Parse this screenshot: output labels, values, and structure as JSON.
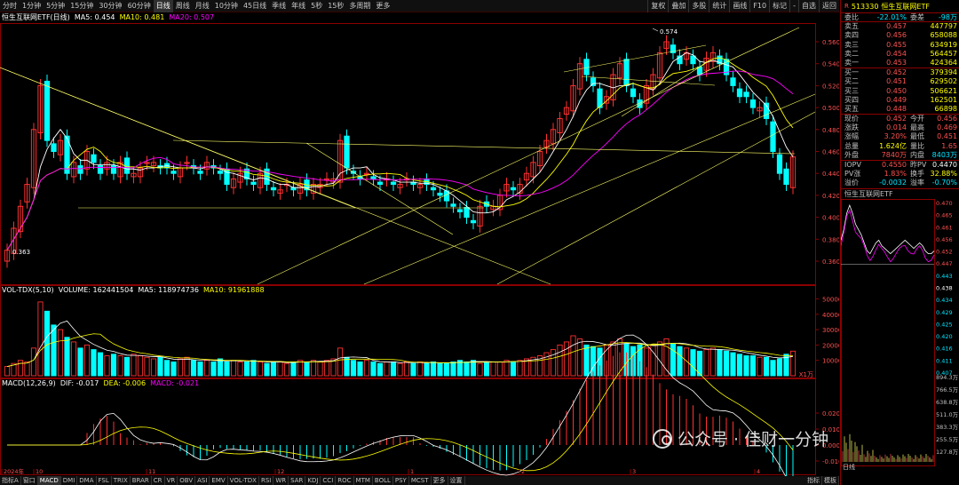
{
  "toolbar": {
    "tabs": [
      "分时",
      "1分钟",
      "5分钟",
      "15分钟",
      "30分钟",
      "60分钟",
      "日线",
      "周线",
      "月线",
      "10分钟",
      "45日线",
      "季线",
      "年线",
      "5秒",
      "15秒",
      "多周期",
      "更多"
    ],
    "active_tab": 6,
    "right_buttons": [
      "复权",
      "叠加",
      "多股",
      "统计",
      "画线",
      "F10",
      "标记",
      "-",
      "自选",
      "返回"
    ]
  },
  "main_chart": {
    "name": "恒生互联网ETF(日线)",
    "ma5_label": "MA5: 0.454",
    "ma10_label": "MA10: 0.481",
    "ma20_label": "MA20: 0.507",
    "price_ticks": [
      "0.560",
      "0.540",
      "0.520",
      "0.500",
      "0.480",
      "0.460",
      "0.440",
      "0.420",
      "0.400",
      "0.380",
      "0.360"
    ],
    "high_label": "0.574",
    "low_label": "0.363",
    "colors": {
      "up": "#ff3030",
      "down": "#00ffff",
      "ma5": "#ffffff",
      "ma10": "#ffff00",
      "ma20": "#ff00ff",
      "trend": "#ffff66"
    }
  },
  "volume_pane": {
    "label": "VOL-TDX(5,10)",
    "volume": "VOLUME: 162441504",
    "ma5": "MA5: 118974736",
    "ma10": "MA10: 91961888",
    "ticks": [
      "50000",
      "40000",
      "30000",
      "20000",
      "10000"
    ],
    "unit": "X1万"
  },
  "macd_pane": {
    "label": "MACD(12,26,9)",
    "dif": "DIF: -0.017",
    "dea": "DEA: -0.006",
    "macd": "MACD: -0.021",
    "ticks": [
      "0.020",
      "0.010",
      "0.000",
      "-0.010"
    ]
  },
  "time_axis": [
    "2024年",
    "10",
    "11",
    "12",
    "1",
    "2",
    "3",
    "4"
  ],
  "bottom_tabs": [
    "指标A",
    "窗口",
    "MACD",
    "DMI",
    "DMA",
    "FSL",
    "TRIX",
    "BRAR",
    "CR",
    "VR",
    "OBV",
    "ASI",
    "EMV",
    "VOL-TDX",
    "RSI",
    "WR",
    "SAR",
    "KDJ",
    "CCI",
    "ROC",
    "MTM",
    "BOLL",
    "PSY",
    "MCST",
    "更多",
    "设置"
  ],
  "bottom_right_tabs": [
    "指标",
    "模板"
  ],
  "active_bottom_tab": 2,
  "quote": {
    "code": "513330",
    "name": "恒生互联网ETF",
    "weibi_label": "委比",
    "weibi": "-22.01%",
    "weicha_label": "委差",
    "weicha": "-98万",
    "asks": [
      {
        "label": "卖五",
        "price": "0.457",
        "vol": "447797"
      },
      {
        "label": "卖四",
        "price": "0.456",
        "vol": "658088"
      },
      {
        "label": "卖三",
        "price": "0.455",
        "vol": "634919"
      },
      {
        "label": "卖二",
        "price": "0.454",
        "vol": "564457"
      },
      {
        "label": "卖一",
        "price": "0.453",
        "vol": "424364"
      }
    ],
    "bids": [
      {
        "label": "买一",
        "price": "0.452",
        "vol": "379394"
      },
      {
        "label": "买二",
        "price": "0.451",
        "vol": "629502"
      },
      {
        "label": "买三",
        "price": "0.450",
        "vol": "506621"
      },
      {
        "label": "买四",
        "price": "0.449",
        "vol": "162501"
      },
      {
        "label": "买五",
        "price": "0.448",
        "vol": "66898"
      }
    ],
    "stats": [
      {
        "l1": "现价",
        "v1": "0.452",
        "l2": "今开",
        "v2": "0.456"
      },
      {
        "l1": "涨跌",
        "v1": "0.014",
        "l2": "最高",
        "v2": "0.469"
      },
      {
        "l1": "涨幅",
        "v1": "3.20%",
        "l2": "最低",
        "v2": "0.451"
      },
      {
        "l1": "总量",
        "v1": "1.624亿",
        "l2": "量比",
        "v2": "1.65"
      },
      {
        "l1": "外盘",
        "v1": "7840万",
        "l2": "内盘",
        "v2": "8403万"
      }
    ],
    "extra": [
      {
        "l1": "IOPV",
        "v1": "0.4550",
        "l2": "昨PV",
        "v2": "0.4470"
      },
      {
        "l1": "PV涨",
        "v1": "1.83%",
        "l2": "换手",
        "v2": "32.88%"
      },
      {
        "l1": "溢价",
        "v1": "-0.0032",
        "l2": "溢率",
        "v2": "-0.70%"
      }
    ]
  },
  "mini_chart": {
    "title": "恒生互联网ETF",
    "ticks": [
      "0.470",
      "0.465",
      "0.461",
      "0.456",
      "0.452",
      "0.447",
      "0.443",
      "0.438",
      "0.434",
      "0.429",
      "0.425",
      "0.420",
      "0.416",
      "0.411",
      "0.407"
    ],
    "vol_ticks": [
      "894.3万",
      "766.5万",
      "638.8万",
      "511.0万",
      "383.3万",
      "255.5万",
      "127.8万"
    ],
    "footer": "日线"
  },
  "watermark": {
    "text": "公众号 · 佳财一分钟"
  }
}
